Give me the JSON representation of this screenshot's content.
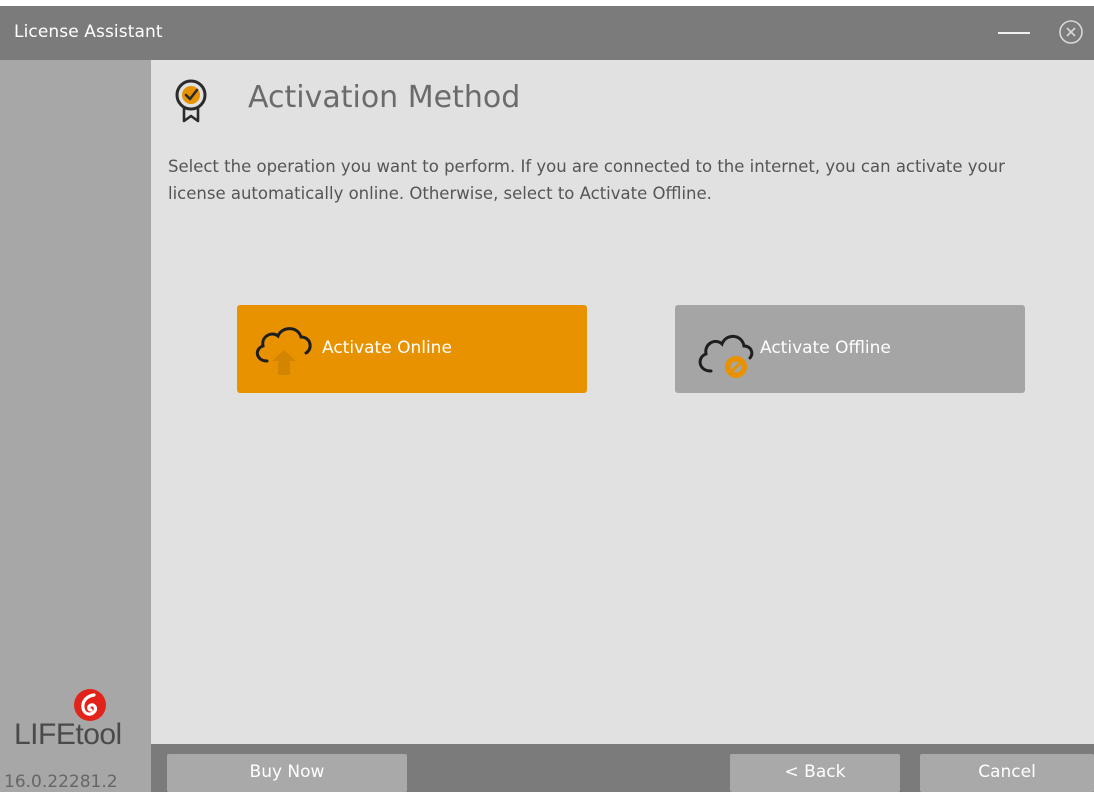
{
  "window": {
    "title": "License Assistant"
  },
  "sidebar": {
    "logo_text": "LIFEtool",
    "version": "16.0.22281.2"
  },
  "main": {
    "title": "Activation Method",
    "description": "Select the operation you want to perform. If you are connected to the internet, you can activate your license automatically online. Otherwise, select to Activate Offline.",
    "online_label": "Activate Online",
    "offline_label": "Activate Offline"
  },
  "footer": {
    "buy_label": "Buy Now",
    "back_label": "< Back",
    "cancel_label": "Cancel"
  },
  "icons": {
    "title_bar": [
      "minimize-icon",
      "close-circle-icon"
    ],
    "heading": "badge-check-icon",
    "online": "cloud-upload-icon",
    "offline": "cloud-offline-icon"
  },
  "colors": {
    "accent": "#e89200",
    "title_bar": "#7b7b7b",
    "sidebar": "#a7a7a7",
    "content_bg": "#e1e1e1",
    "offline_button": "#a5a5a5",
    "logo_red": "#e2231a"
  }
}
